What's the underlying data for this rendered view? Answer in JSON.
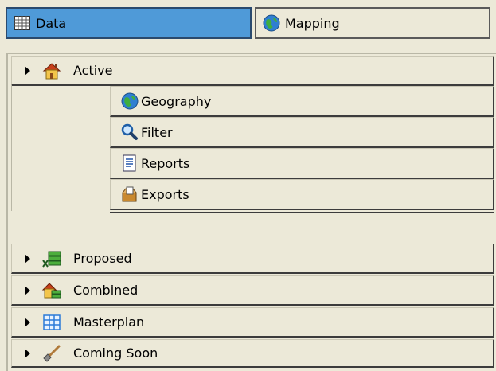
{
  "tabs": [
    {
      "label": "Data",
      "icon": "grid-icon",
      "active": true
    },
    {
      "label": "Mapping",
      "icon": "globe-icon",
      "active": false
    }
  ],
  "groups": {
    "active": {
      "label": "Active",
      "icon": "house-icon",
      "expanded": true
    },
    "proposed": {
      "label": "Proposed",
      "icon": "proposed-icon"
    },
    "combined": {
      "label": "Combined",
      "icon": "combined-icon"
    },
    "masterplan": {
      "label": "Masterplan",
      "icon": "masterplan-icon"
    },
    "coming_soon": {
      "label": "Coming Soon",
      "icon": "shovel-icon"
    }
  },
  "active_items": [
    {
      "label": "Geography",
      "icon": "globe-icon"
    },
    {
      "label": "Filter",
      "icon": "magnifier-icon"
    },
    {
      "label": "Reports",
      "icon": "report-icon"
    },
    {
      "label": "Exports",
      "icon": "export-icon"
    }
  ],
  "colors": {
    "active_tab": "#4f9ad8",
    "panel": "#ece9d8"
  }
}
